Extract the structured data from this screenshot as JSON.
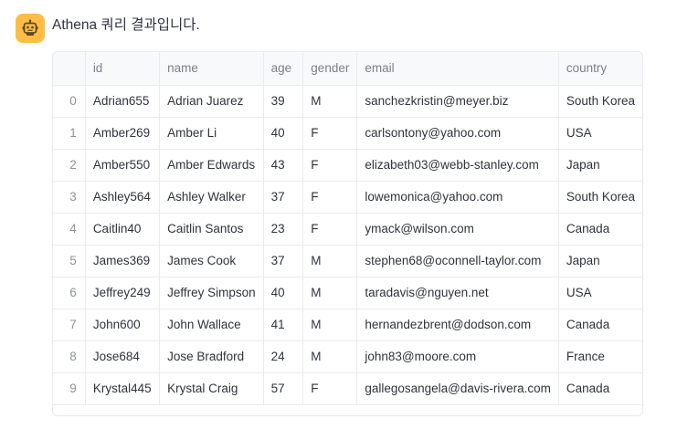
{
  "chat": {
    "message": "Athena 쿼리 결과입니다.",
    "avatar_icon": "robot-icon",
    "avatar_color": "#ffbd45"
  },
  "table": {
    "columns": [
      "",
      "id",
      "name",
      "age",
      "gender",
      "email",
      "country"
    ],
    "rows": [
      {
        "index": "0",
        "id": "Adrian655",
        "name": "Adrian Juarez",
        "age": "39",
        "gender": "M",
        "email": "sanchezkristin@meyer.biz",
        "country": "South Korea"
      },
      {
        "index": "1",
        "id": "Amber269",
        "name": "Amber Li",
        "age": "40",
        "gender": "F",
        "email": "carlsontony@yahoo.com",
        "country": "USA"
      },
      {
        "index": "2",
        "id": "Amber550",
        "name": "Amber Edwards",
        "age": "43",
        "gender": "F",
        "email": "elizabeth03@webb-stanley.com",
        "country": "Japan"
      },
      {
        "index": "3",
        "id": "Ashley564",
        "name": "Ashley Walker",
        "age": "37",
        "gender": "F",
        "email": "lowemonica@yahoo.com",
        "country": "South Korea"
      },
      {
        "index": "4",
        "id": "Caitlin40",
        "name": "Caitlin Santos",
        "age": "23",
        "gender": "F",
        "email": "ymack@wilson.com",
        "country": "Canada"
      },
      {
        "index": "5",
        "id": "James369",
        "name": "James Cook",
        "age": "37",
        "gender": "M",
        "email": "stephen68@oconnell-taylor.com",
        "country": "Japan"
      },
      {
        "index": "6",
        "id": "Jeffrey249",
        "name": "Jeffrey Simpson",
        "age": "40",
        "gender": "M",
        "email": "taradavis@nguyen.net",
        "country": "USA"
      },
      {
        "index": "7",
        "id": "John600",
        "name": "John Wallace",
        "age": "41",
        "gender": "M",
        "email": "hernandezbrent@dodson.com",
        "country": "Canada"
      },
      {
        "index": "8",
        "id": "Jose684",
        "name": "Jose Bradford",
        "age": "24",
        "gender": "M",
        "email": "john83@moore.com",
        "country": "France"
      },
      {
        "index": "9",
        "id": "Krystal445",
        "name": "Krystal Craig",
        "age": "57",
        "gender": "F",
        "email": "gallegosangela@davis-rivera.com",
        "country": "Canada"
      }
    ]
  }
}
